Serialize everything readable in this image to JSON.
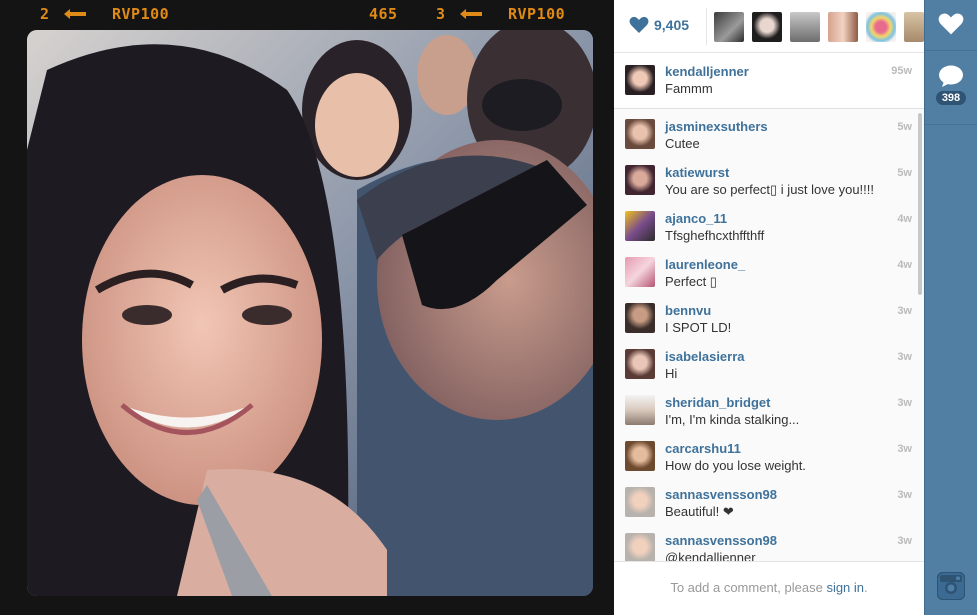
{
  "film": {
    "left_frame": "2",
    "brand_left": "RVP100",
    "frame_code": "465",
    "right_frame": "3",
    "brand_right": "RVP100"
  },
  "likes": {
    "count": "9,405",
    "icon": "heart-icon"
  },
  "caption": {
    "username": "kendalljenner",
    "text": "Fammm",
    "time": "95w"
  },
  "comments": [
    {
      "username": "jasminexsuthers",
      "text": "Cutee",
      "time": "5w"
    },
    {
      "username": "katiewurst",
      "text": "You are so perfect▯ i just love you!!!!",
      "time": "5w"
    },
    {
      "username": "ajanco_11",
      "text": "Tfsghefhcxthffthff",
      "time": "4w"
    },
    {
      "username": "laurenleone_",
      "text": "Perfect ▯",
      "time": "4w"
    },
    {
      "username": "bennvu",
      "text": "I SPOT LD!",
      "time": "3w"
    },
    {
      "username": "isabelasierra",
      "text": "Hi",
      "time": "3w"
    },
    {
      "username": "sheridan_bridget",
      "text": "I'm, I'm kinda stalking...",
      "time": "3w"
    },
    {
      "username": "carcarshu11",
      "text": "How do you lose weight.",
      "time": "3w"
    },
    {
      "username": "sannasvensson98",
      "text": "Beautiful! ❤",
      "time": "3w"
    },
    {
      "username": "sannasvensson98",
      "text": "@kendalljenner",
      "time": "3w"
    }
  ],
  "footer": {
    "prefix": "To add a comment, please ",
    "link": "sign in",
    "suffix": "."
  },
  "actions": {
    "like_icon": "heart-icon",
    "comment_icon": "speech-bubble-icon",
    "comment_count": "398",
    "logo_icon": "instagram-camera-icon"
  },
  "colors": {
    "accent_blue": "#3f729b",
    "sidebar_blue": "#517fa4",
    "film_orange": "#e08a17"
  }
}
